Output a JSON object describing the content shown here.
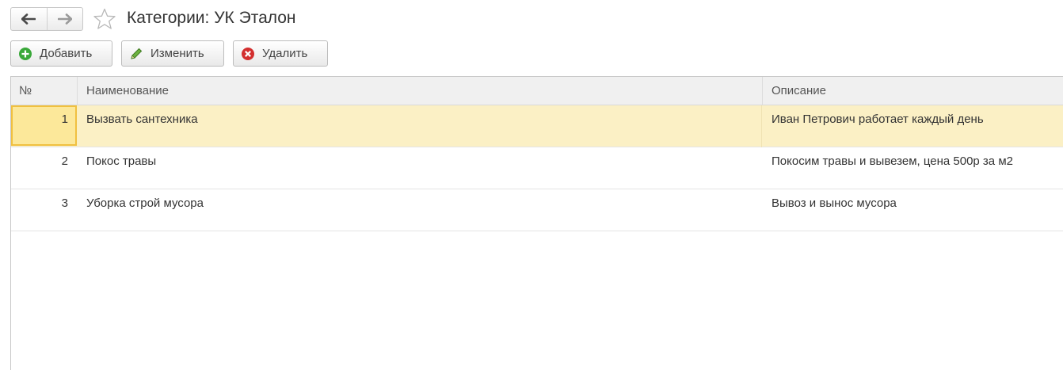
{
  "header": {
    "title": "Категории: УК Эталон"
  },
  "toolbar": {
    "add_label": "Добавить",
    "edit_label": "Изменить",
    "delete_label": "Удалить"
  },
  "colors": {
    "add_icon": "#3aa83a",
    "edit_icon": "#4e8f2e",
    "delete_icon": "#d32f2f",
    "selected_row": "#fbf0c5",
    "selected_cell_border": "#f0c040"
  },
  "table": {
    "columns": [
      "№",
      "Наименование",
      "Описание"
    ],
    "rows": [
      {
        "num": "1",
        "name": "Вызвать сантехника",
        "desc": "Иван Петрович работает каждый день",
        "selected": true
      },
      {
        "num": "2",
        "name": "Покос травы",
        "desc": "Покосим травы и вывезем, цена 500р за м2",
        "selected": false
      },
      {
        "num": "3",
        "name": "Уборка строй мусора",
        "desc": "Вывоз и вынос мусора",
        "selected": false
      }
    ]
  },
  "icons": {
    "back": "arrow-left-icon",
    "forward": "arrow-right-icon",
    "favorite": "star-outline-icon",
    "add": "plus-circle-icon",
    "edit": "pencil-icon",
    "delete": "x-circle-icon"
  }
}
